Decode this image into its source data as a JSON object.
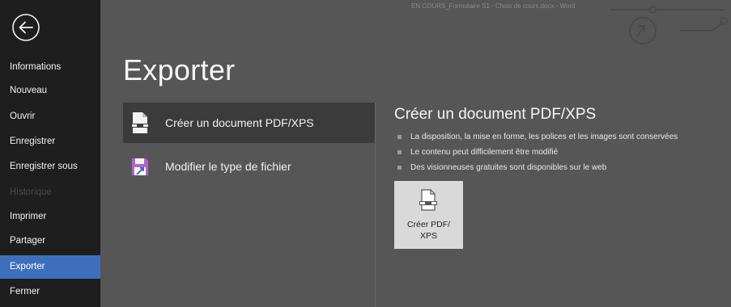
{
  "window": {
    "title": "EN COURS_Formulaire S1 - Choix de cours.docx  -  Word"
  },
  "nav": {
    "back_icon": "back-arrow-circle-icon",
    "items": [
      {
        "label": "Informations",
        "state": "normal"
      },
      {
        "label": "Nouveau",
        "state": "normal"
      },
      {
        "label": "Ouvrir",
        "state": "normal"
      },
      {
        "label": "Enregistrer",
        "state": "normal"
      },
      {
        "label": "Enregistrer sous",
        "state": "normal"
      },
      {
        "label": "Historique",
        "state": "disabled"
      },
      {
        "label": "Imprimer",
        "state": "normal"
      },
      {
        "label": "Partager",
        "state": "normal"
      },
      {
        "label": "Exporter",
        "state": "active"
      },
      {
        "label": "Fermer",
        "state": "normal"
      }
    ]
  },
  "main": {
    "title": "Exporter",
    "options": [
      {
        "label": "Créer un document PDF/XPS",
        "icon": "pdf-document-icon",
        "selected": true
      },
      {
        "label": "Modifier le type de fichier",
        "icon": "change-file-type-icon",
        "selected": false
      }
    ],
    "detail": {
      "title": "Créer un document PDF/XPS",
      "bullets": [
        "La disposition, la mise en forme, les polices et les images sont conservées",
        "Le contenu peut difficilement être modifié",
        "Des visionneuses gratuites sont disponibles sur le web"
      ],
      "button": {
        "line1": "Créer PDF/",
        "line2": "XPS",
        "icon": "pdf-document-icon"
      }
    }
  },
  "colors": {
    "nav_bg": "#1e1e1e",
    "main_bg": "#565656",
    "active": "#3e6fbd",
    "selected_option": "#3b3b3b",
    "button_bg": "#d9d9d9"
  }
}
